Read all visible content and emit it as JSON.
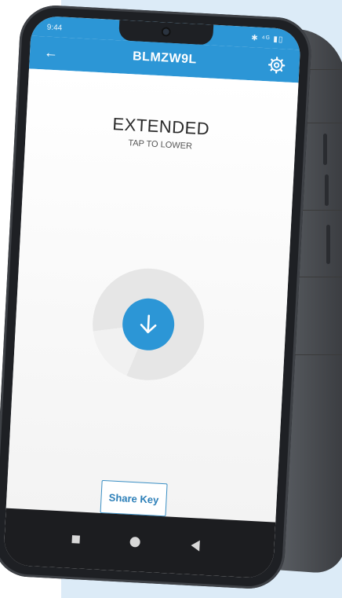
{
  "status_bar": {
    "time": "9:44",
    "indicators": "✱ ⁴ᴳ ▮▯"
  },
  "app_bar": {
    "back_icon": "arrow-left-icon",
    "title": "BLMZW9L",
    "settings_icon": "gear-icon"
  },
  "main": {
    "state_label": "EXTENDED",
    "hint_label": "TAP TO LOWER",
    "action_icon": "arrow-down-icon",
    "share_button_label": "Share Key"
  },
  "nav_bar": {
    "items": [
      "square-icon",
      "circle-icon",
      "triangle-back-icon"
    ]
  },
  "colors": {
    "accent": "#2c96d6",
    "background_panel": "#dcebf7"
  }
}
